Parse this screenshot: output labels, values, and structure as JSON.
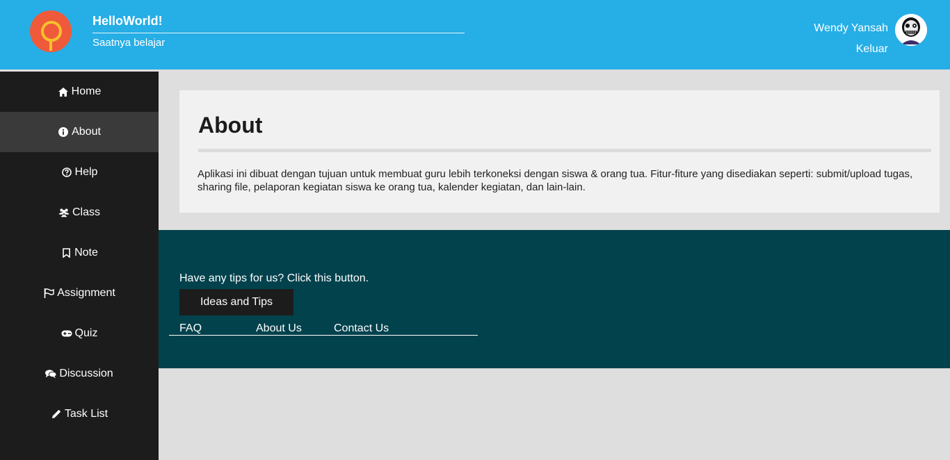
{
  "header": {
    "brand_title": "HelloWorld!",
    "brand_subtitle": "Saatnya belajar",
    "user_name": "Wendy Yansah",
    "logout_label": "Keluar"
  },
  "sidebar": {
    "items": [
      {
        "label": "Home",
        "icon": "home-icon"
      },
      {
        "label": "About",
        "icon": "info-icon"
      },
      {
        "label": "Help",
        "icon": "question-icon"
      },
      {
        "label": "Class",
        "icon": "users-icon"
      },
      {
        "label": "Note",
        "icon": "bookmark-icon"
      },
      {
        "label": "Assignment",
        "icon": "flag-icon"
      },
      {
        "label": "Quiz",
        "icon": "gamepad-icon"
      },
      {
        "label": "Discussion",
        "icon": "comments-icon"
      },
      {
        "label": "Task List",
        "icon": "pencil-icon"
      }
    ],
    "active": "About"
  },
  "main": {
    "title": "About",
    "body": "Aplikasi ini dibuat dengan tujuan untuk membuat guru lebih terkoneksi dengan siswa & orang tua. Fitur-fiture yang disediakan seperti: submit/upload tugas, sharing file, pelaporan kegiatan siswa ke orang tua, kalender kegiatan, dan lain-lain."
  },
  "footer": {
    "tips_text": "Have any tips for us? Click this button.",
    "tips_button": "Ideas and Tips",
    "links": [
      "FAQ",
      "About Us",
      "Contact Us"
    ]
  },
  "colors": {
    "header_bg": "#26aee6",
    "sidebar_bg": "#1c1c1c",
    "sidebar_active_bg": "#3a3a3a",
    "footer_bg": "#02424d",
    "page_bg": "#dedede",
    "card_bg": "#f1f1f1",
    "logo_bg": "#ef5a3a",
    "logo_accent": "#f6c22b"
  }
}
